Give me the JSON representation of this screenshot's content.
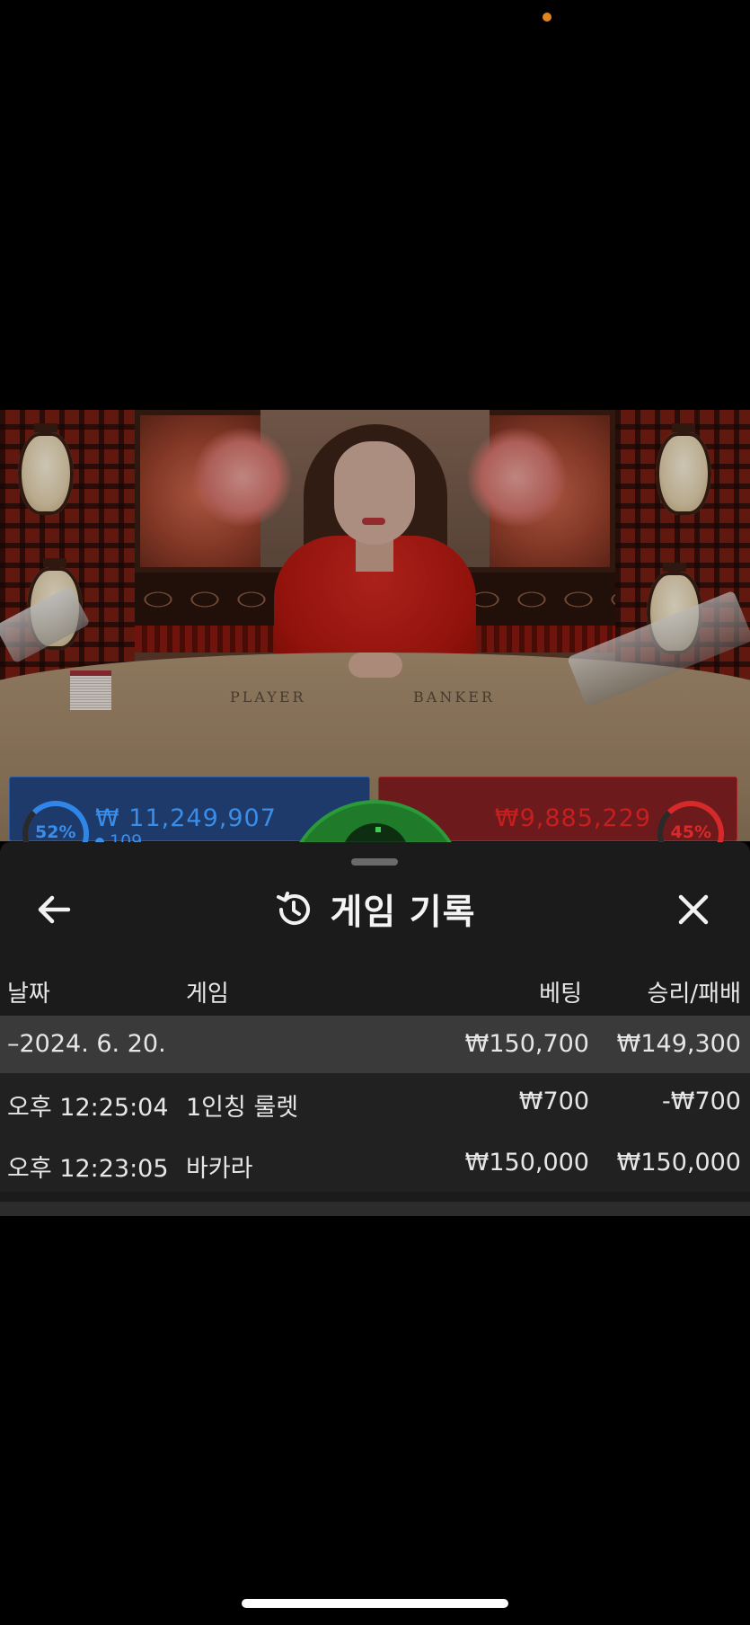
{
  "player_bet": {
    "percent": "52%",
    "amount": "₩ 11,249,907",
    "count": "109"
  },
  "banker_bet": {
    "percent": "45%",
    "amount": "₩9,885,229"
  },
  "table_labels": {
    "player": "PLAYER",
    "banker": "BANKER"
  },
  "history": {
    "title": "게임 기록",
    "icons": {
      "back": "arrow-left-icon",
      "title": "history-icon",
      "close": "close-icon"
    },
    "columns": {
      "date": "날짜",
      "game": "게임",
      "bet": "베팅",
      "result": "승리/패배"
    },
    "group": {
      "date": "–2024. 6. 20.",
      "bet_total": "₩150,700",
      "result_total": "₩149,300"
    },
    "rows": [
      {
        "time": "오후 12:25:04",
        "game": "1인칭 룰렛",
        "bet": "₩700",
        "result": "-₩700"
      },
      {
        "time": "오후 12:23:05",
        "game": "바카라",
        "bet": "₩150,000",
        "result": "₩150,000"
      }
    ]
  },
  "colors": {
    "sheet_bg": "#1b1b1b",
    "player_blue": "#3a8de8",
    "banker_red": "#c71e20",
    "status_dot": "#e0861c"
  }
}
